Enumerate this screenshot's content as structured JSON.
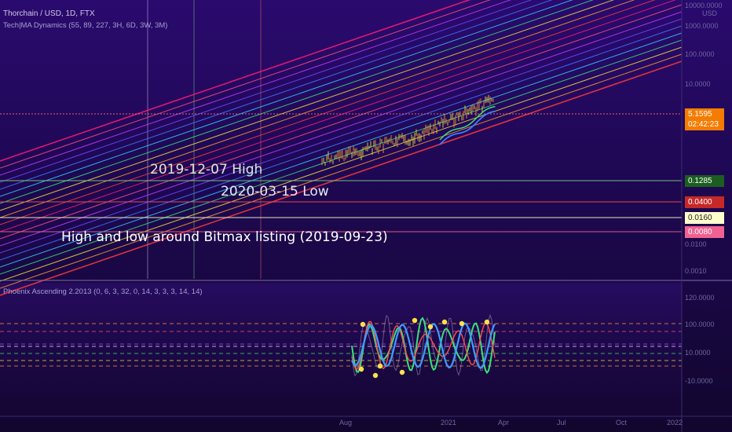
{
  "header": {
    "symbol_line": "Thorchain / USD, 1D, FTX",
    "indicator_line": "Tech|MA Dynamics (55, 89, 227, 3H, 6D, 3W, 3M)",
    "oscillator_line": "Phoenix Ascending 2.2013 (0, 6, 3, 32, 0, 14, 3, 3, 3, 14, 14)"
  },
  "annotations": {
    "high_2019": "2019-12-07 High",
    "low_2020": "2020-03-15 Low",
    "bitmax": "High and low around Bitmax listing (2019-09-23)"
  },
  "price_tags": {
    "last": "5.1595",
    "countdown": "02:42:23",
    "level_1": "0.1285",
    "level_2": "0.0400",
    "level_3": "0.0160",
    "level_4": "0.0080"
  },
  "price_axis": {
    "unit": "USD",
    "labels": [
      "10000.0000",
      "1000.0000",
      "100.0000",
      "10.0000",
      "0.0100",
      "0.0010",
      "120.0000",
      "100.0000",
      "10.0000",
      "-10.0000"
    ]
  },
  "time_axis": {
    "labels": [
      "Aug",
      "2021",
      "Apr",
      "Jul",
      "Oct",
      "2022"
    ]
  },
  "colors": {
    "background_top": "#2a0a6e",
    "background_bottom": "#12062e",
    "last_tag": "#f57c00",
    "level_1_tag": "#1b5e20",
    "level_2_tag": "#c62828",
    "level_3_tag": "#ffffcc",
    "level_4_tag": "#f06292",
    "band_colors": [
      "#ff1a75",
      "#ff4d8a",
      "#c33cff",
      "#6a4cff",
      "#3d7bff",
      "#2fd0ff",
      "#38e07a",
      "#f2e23b",
      "#ff9a2e",
      "#ff3b3b"
    ]
  },
  "chart_data": [
    {
      "type": "line",
      "title": "Thorchain / USD, 1D, FTX",
      "scale": "log",
      "ylim": [
        0.001,
        10000
      ],
      "series": [
        {
          "name": "Thorchain / USD",
          "x": [
            "2020-08",
            "2020-10",
            "2020-12",
            "2021-01",
            "2021-02",
            "2021-03"
          ],
          "y": [
            0.9,
            1.1,
            1.4,
            2.0,
            3.5,
            5.1595
          ]
        }
      ],
      "horizontal_levels": [
        0.1285,
        0.04,
        0.016,
        0.008
      ],
      "last_price": 5.1595
    },
    {
      "type": "line",
      "title": "Phoenix Ascending 2.2013 (0, 6, 3, 32, 0, 14, 3, 3, 3, 14, 14)",
      "ylim": [
        -10,
        120
      ]
    }
  ]
}
